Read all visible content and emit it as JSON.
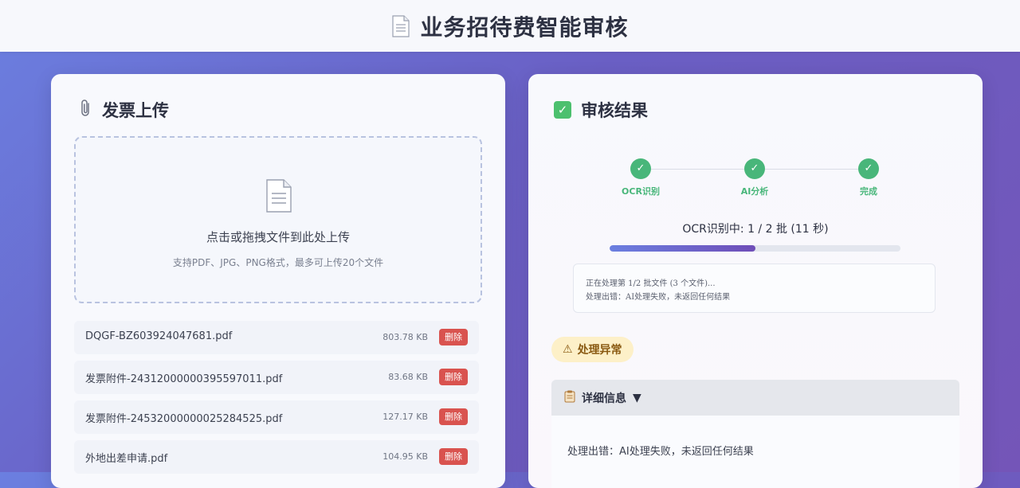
{
  "app": {
    "title": "业务招待费智能审核",
    "title_icon": "document-icon"
  },
  "upload": {
    "title": "发票上传",
    "title_icon": "paperclip-icon",
    "dropzone_main": "点击或拖拽文件到此处上传",
    "dropzone_sub": "支持PDF、JPG、PNG格式，最多可上传20个文件",
    "files": [
      {
        "name": "DQGF-BZ603924047681.pdf",
        "size": "803.78 KB",
        "delete": "删除"
      },
      {
        "name": "发票附件-24312000000395597011.pdf",
        "size": "83.68 KB",
        "delete": "删除"
      },
      {
        "name": "发票附件-24532000000025284525.pdf",
        "size": "127.17 KB",
        "delete": "删除"
      },
      {
        "name": "外地出差申请.pdf",
        "size": "104.95 KB",
        "delete": "删除"
      }
    ]
  },
  "result": {
    "title": "审核结果",
    "title_icon": "check-square-icon",
    "steps": [
      {
        "label": "OCR识别",
        "mark": "✓"
      },
      {
        "label": "AI分析",
        "mark": "✓"
      },
      {
        "label": "完成",
        "mark": "✓"
      }
    ],
    "status": "OCR识别中: 1 / 2 批 (11 秒)",
    "progress_fraction": 0.5,
    "log": [
      "正在处理第 1/2 批文件 (3 个文件)...",
      "处理出错：AI处理失败，未返回任何结果"
    ],
    "warning_badge": "处理异常",
    "warning_icon": "⚠",
    "details_label": "详细信息",
    "details_toggle": "▼",
    "details_icon": "clipboard-icon",
    "details_text": "处理出错：AI处理失败，未返回任何结果"
  },
  "colors": {
    "accent": "#6b7fe0",
    "success": "#48b67a",
    "danger": "#d9534f",
    "warning_bg": "#fdf0c8"
  }
}
